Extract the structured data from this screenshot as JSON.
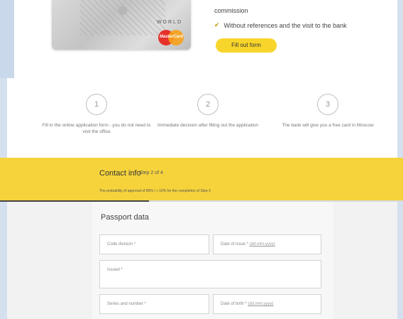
{
  "hero": {
    "commission_text": "commission",
    "benefit_text": "Without references and the visit to the bank",
    "fill_button": "Fill out form",
    "card_world": "WORLD",
    "card_brand": "MasterCard"
  },
  "steps": [
    {
      "number": "1",
      "text": "Fill in the online application form - you do not need to visit the office"
    },
    {
      "number": "2",
      "text": "Immediate decision after filling out the application"
    },
    {
      "number": "3",
      "text": "The bank will give you a free card in Moscow"
    }
  ],
  "contact": {
    "title": "Contact info",
    "step": "Step 2 of 4",
    "sub": "The probability of approval of 80%  |  + 10% for the completion of Step 3"
  },
  "form": {
    "title": "Passport data",
    "code_division": "Code division *",
    "date_issue": "Date of issue *",
    "date_issue_hint": "(dd.mm.yyyy)",
    "issued": "Issued *",
    "series_number": "Series and number *",
    "date_birth": "Date of birth *",
    "date_birth_hint": "(dd.mm.yyyy)"
  }
}
